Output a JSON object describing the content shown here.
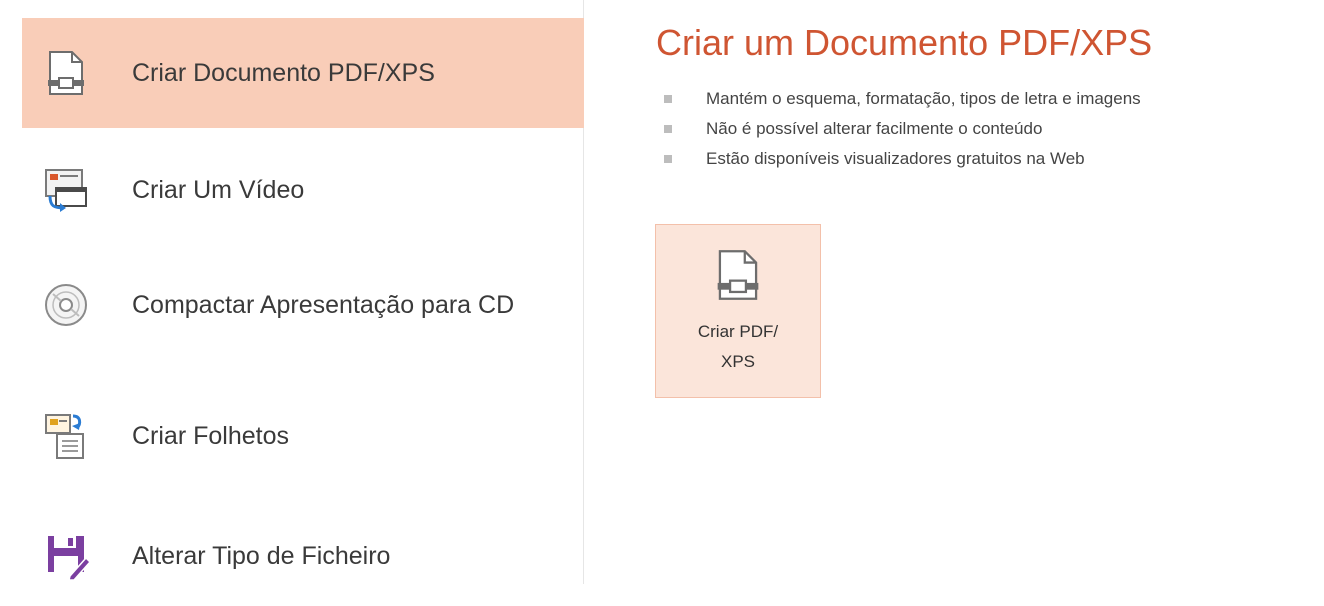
{
  "sidebar": {
    "items": [
      {
        "label": "Criar Documento PDF/XPS",
        "icon": "pdf-document-icon",
        "active": true
      },
      {
        "label": "Criar Um Vídeo",
        "icon": "video-icon",
        "active": false
      },
      {
        "label": "Compactar Apresentação para CD",
        "icon": "cd-icon",
        "active": false
      },
      {
        "label": "Criar Folhetos",
        "icon": "handouts-icon",
        "active": false
      },
      {
        "label": "Alterar Tipo de Ficheiro",
        "icon": "save-as-icon",
        "active": false
      }
    ]
  },
  "main": {
    "title": "Criar um Documento PDF/XPS",
    "bullets": [
      "Mantém o esquema, formatação, tipos de letra e imagens",
      "Não é possível alterar facilmente o conteúdo",
      "Estão disponíveis visualizadores gratuitos na Web"
    ],
    "button": {
      "line1": "Criar PDF/",
      "line2": "XPS",
      "icon": "pdf-document-icon"
    }
  },
  "colors": {
    "accent": "#cf5532",
    "active_bg": "#f9cdb8",
    "button_bg": "#fbe5da",
    "button_border": "#f3c0aa"
  }
}
